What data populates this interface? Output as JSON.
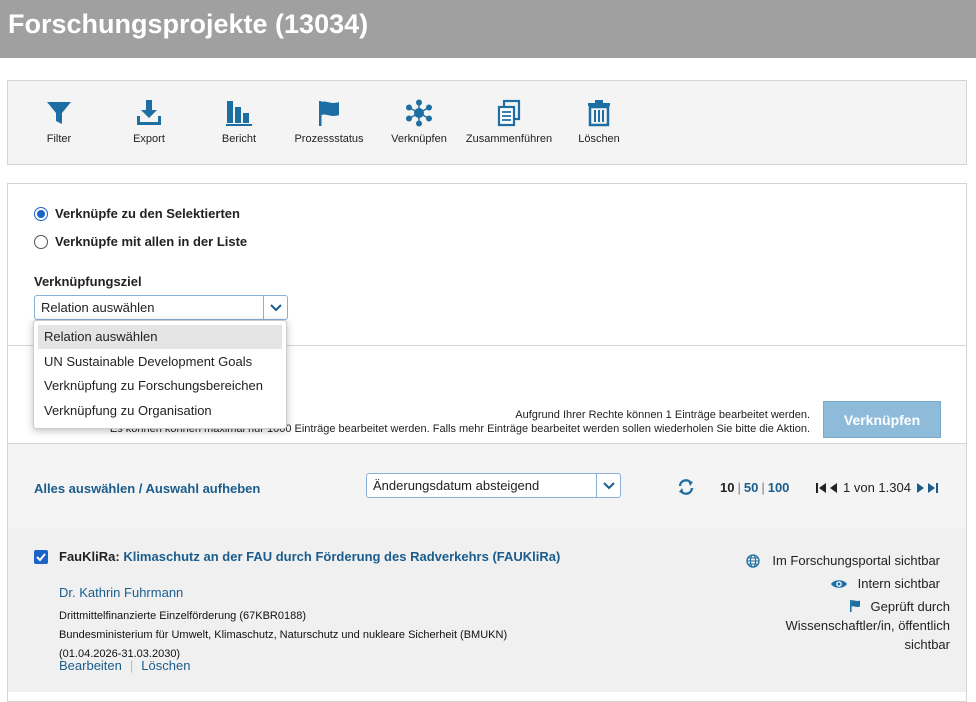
{
  "header": {
    "title": "Forschungsprojekte (13034)"
  },
  "toolbar": {
    "filter": "Filter",
    "export": "Export",
    "report": "Bericht",
    "process_status": "Prozessstatus",
    "link": "Verknüpfen",
    "merge": "Zusammenführen",
    "delete": "Löschen"
  },
  "link_panel": {
    "option_selected": "Verknüpfe zu den Selektierten",
    "option_all": "Verknüpfe mit allen in der Liste",
    "target_label": "Verknüpfungsziel",
    "select_value": "Relation auswählen",
    "dropdown_options": [
      "Relation auswählen",
      "UN Sustainable Development Goals",
      "Verknüpfung zu Forschungsbereichen",
      "Verknüpfung zu Organisation"
    ],
    "info_rights": "Aufgrund Ihrer Rechte können 1 Einträge bearbeitet werden.",
    "info_max": "Es können können maximal nur 1000 Einträge bearbeitet werden. Falls mehr Einträge bearbeitet werden sollen wiederholen Sie bitte die Aktion.",
    "button": "Verknüpfen"
  },
  "list_controls": {
    "select_all": "Alles auswählen / Auswahl aufheben",
    "sort_value": "Änderungsdatum absteigend",
    "per_page": [
      "10",
      "50",
      "100"
    ],
    "per_page_sep": "|",
    "page_info": "1 von 1.304"
  },
  "result": {
    "acronym": "FauKliRa",
    "colon": ":",
    "title": "Klimaschutz an der FAU durch Förderung des Radverkehrs (FAUKliRa)",
    "person": "Dr. Kathrin Fuhrmann",
    "funding": "Drittmittelfinanzierte Einzelförderung (67KBR0188)",
    "funder": "Bundesministerium für Umwelt, Klimaschutz, Naturschutz und nukleare Sicherheit (BMUKN)",
    "period": "(01.04.2026-31.03.2030)",
    "edit": "Bearbeiten",
    "delete": "Löschen",
    "status_portal": "Im Forschungsportal sichtbar",
    "status_intern": "Intern sichtbar",
    "status_checked": "Geprüft durch Wissenschaftler/in, öffentlich sichtbar"
  },
  "colors": {
    "accent": "#1a5d8c",
    "icon": "#1d6fa3",
    "button": "#8dbbd9"
  },
  "icons": [
    "filter-icon",
    "export-icon",
    "report-icon",
    "flag-icon",
    "link-icon",
    "merge-icon",
    "trash-icon",
    "refresh-icon",
    "globe-icon",
    "eye-icon"
  ]
}
